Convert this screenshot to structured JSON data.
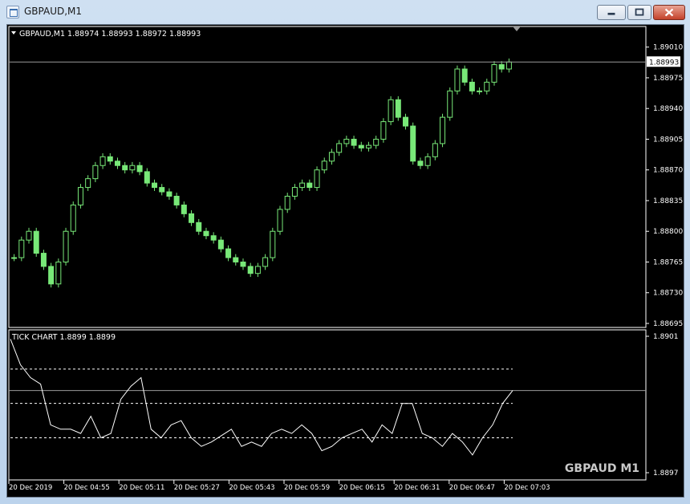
{
  "window": {
    "title": "GBPAUD,M1",
    "buttons": [
      "minimize",
      "maximize",
      "close"
    ]
  },
  "main_chart": {
    "header": "GBPAUD,M1  1.88974 1.88993 1.88972 1.88993",
    "symbol": "GBPAUD",
    "timeframe": "M1",
    "ohlc": {
      "open": 1.88974,
      "high": 1.88993,
      "low": 1.88972,
      "close": 1.88993
    },
    "current_price_label": "1.88993",
    "candle_color": "#78e878",
    "price_line_color": "#9a9a9a"
  },
  "tick_indicator": {
    "label": "TICK CHART 1.8899 1.8899",
    "watermark": "GBPAUD M1",
    "line_color": "#ffffff"
  },
  "chart_data": [
    {
      "type": "line",
      "title": "GBPAUD,M1",
      "series": [
        {
          "name": "GBPAUD",
          "values": [
            1.8877,
            1.8879,
            1.888,
            1.88775,
            1.8876,
            1.8874,
            1.88765,
            1.888,
            1.8883,
            1.8885,
            1.8886,
            1.88875,
            1.88885,
            1.8888,
            1.88875,
            1.8887,
            1.88875,
            1.88868,
            1.88855,
            1.8885,
            1.88845,
            1.8884,
            1.8883,
            1.8882,
            1.8881,
            1.888,
            1.88795,
            1.8879,
            1.8878,
            1.8877,
            1.88765,
            1.8876,
            1.88752,
            1.8876,
            1.8877,
            1.888,
            1.88825,
            1.8884,
            1.8885,
            1.88855,
            1.8885,
            1.8887,
            1.8888,
            1.8889,
            1.889,
            1.88905,
            1.88898,
            1.88895,
            1.88898,
            1.88905,
            1.88925,
            1.8895,
            1.8893,
            1.8892,
            1.8888,
            1.88875,
            1.88885,
            1.889,
            1.8893,
            1.8896,
            1.88985,
            1.8897,
            1.8896,
            1.8896,
            1.8897,
            1.8899,
            1.88985,
            1.88993
          ]
        }
      ],
      "ylabel": "",
      "ylim": [
        1.88695,
        1.89028
      ],
      "y_ticks": [
        "1.89010",
        "1.88975",
        "1.88940",
        "1.88905",
        "1.88870",
        "1.88835",
        "1.88800",
        "1.88765",
        "1.88730",
        "1.88695"
      ],
      "grid": false
    },
    {
      "type": "line",
      "title": "TICK CHART 1.8899 1.8899",
      "series": [
        {
          "name": "",
          "values": [
            1.89008,
            1.88996,
            1.8899,
            1.88987,
            1.88968,
            1.88966,
            1.88966,
            1.88964,
            1.88972,
            1.88962,
            1.88964,
            1.8898,
            1.88986,
            1.8899,
            1.88966,
            1.88962,
            1.88968,
            1.8897,
            1.88962,
            1.88958,
            1.8896,
            1.88963,
            1.88966,
            1.88958,
            1.8896,
            1.88958,
            1.88964,
            1.88966,
            1.88964,
            1.88968,
            1.88964,
            1.88956,
            1.88958,
            1.88962,
            1.88964,
            1.88966,
            1.8896,
            1.88968,
            1.88964,
            1.88978,
            1.88978,
            1.88964,
            1.88962,
            1.88958,
            1.88964,
            1.8896,
            1.88954,
            1.88962,
            1.88968,
            1.88978,
            1.88984
          ]
        }
      ],
      "ylim": [
        1.88945,
        1.8901
      ],
      "y_ticks": [
        "1.8901",
        "1.8897"
      ],
      "x_ticks": [
        "20 Dec 2019",
        "20 Dec 04:55",
        "20 Dec 05:11",
        "20 Dec 05:27",
        "20 Dec 05:43",
        "20 Dec 05:59",
        "20 Dec 06:15",
        "20 Dec 06:31",
        "20 Dec 06:47",
        "20 Dec 07:03"
      ]
    }
  ]
}
